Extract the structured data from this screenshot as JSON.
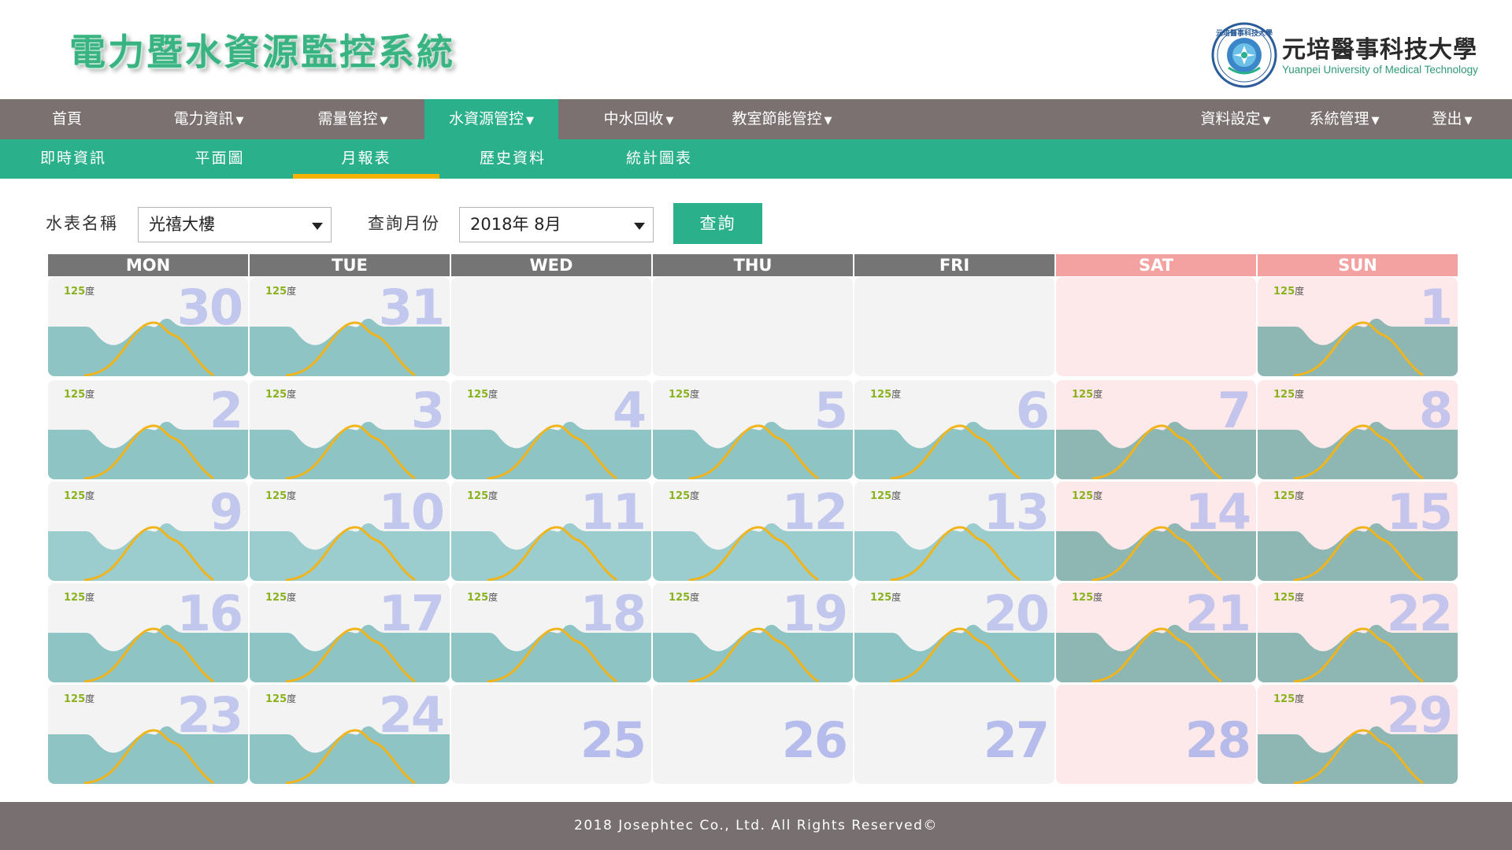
{
  "app": {
    "title": "電力暨水資源監控系統"
  },
  "university": {
    "name": "元培醫事科技大學",
    "name_en": "Yuanpei University of Medical Technology",
    "seal_text": "元培醫事科技大學"
  },
  "main_nav": {
    "left": [
      "首頁",
      "電力資訊",
      "需量管控",
      "水資源管控",
      "中水回收",
      "教室節能管控"
    ],
    "right": [
      "資料設定",
      "系統管理",
      "登出"
    ],
    "active": "水資源管控"
  },
  "sub_nav": {
    "items": [
      "即時資訊",
      "平面圖",
      "月報表",
      "歷史資料",
      "統計圖表"
    ],
    "active": "月報表"
  },
  "query": {
    "meter_label": "水表名稱",
    "meter_value": "光禧大樓",
    "month_label": "查詢月份",
    "month_value": "2018年 8月",
    "submit_label": "查詢"
  },
  "calendar": {
    "weekdays": [
      "MON",
      "TUE",
      "WED",
      "THU",
      "FRI",
      "SAT",
      "SUN"
    ],
    "reading_value": "125",
    "reading_unit": "度",
    "weeks": [
      [
        30,
        31,
        null,
        null,
        null,
        null,
        1
      ],
      [
        2,
        3,
        4,
        5,
        6,
        7,
        8
      ],
      [
        9,
        10,
        11,
        12,
        13,
        14,
        15
      ],
      [
        16,
        17,
        18,
        19,
        20,
        21,
        22
      ],
      [
        23,
        24,
        25,
        26,
        27,
        28,
        29
      ]
    ],
    "has_data": [
      [
        true,
        true,
        false,
        false,
        false,
        false,
        true
      ],
      [
        true,
        true,
        true,
        true,
        true,
        true,
        true
      ],
      [
        true,
        true,
        true,
        true,
        true,
        true,
        true
      ],
      [
        true,
        true,
        true,
        true,
        true,
        true,
        true
      ],
      [
        true,
        true,
        false,
        false,
        false,
        false,
        true
      ]
    ]
  },
  "colors": {
    "accent": "#2bb08c",
    "nav_bg": "#7a7170",
    "tab_highlight": "#f5b300",
    "curve": "#f0b41c",
    "area_fill": "#8ec4c4",
    "weekend": "#f4a1a1"
  },
  "footer": {
    "text": "2018 Josephtec Co., Ltd. All Rights Reserved©"
  }
}
